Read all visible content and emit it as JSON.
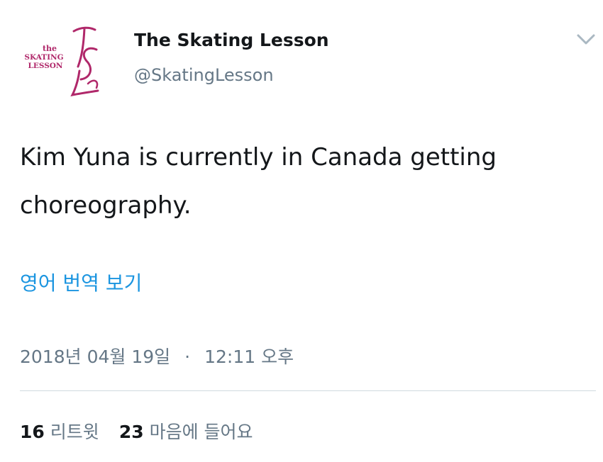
{
  "user": {
    "display_name": "The Skating Lesson",
    "handle": "@SkatingLesson",
    "avatar": {
      "icon": "skating-lesson-logo-icon",
      "logo_text_line1": "the",
      "logo_text_line2": "SKATING",
      "logo_text_line3": "LESSON",
      "brand_color": "#b0286a"
    }
  },
  "menu": {
    "icon": "chevron-down-icon"
  },
  "tweet": {
    "text": "Kim Yuna is currently in Canada getting choreography.",
    "translate_label": "영어 번역 보기",
    "date": "2018년 04월 19일",
    "separator": "·",
    "time": "12:11 오후"
  },
  "stats": {
    "retweets_count": "16",
    "retweets_label": "리트윗",
    "likes_count": "23",
    "likes_label": "마음에 들어요"
  },
  "colors": {
    "text": "#14171a",
    "secondary": "#657786",
    "link": "#1b95e0",
    "divider": "#cfd9de"
  }
}
